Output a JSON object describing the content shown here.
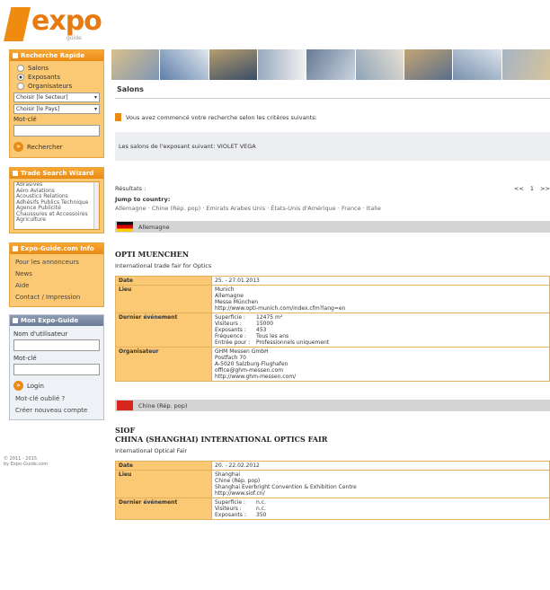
{
  "logo": {
    "word": "expo",
    "sub": "guide"
  },
  "sidebar": {
    "quick_search": {
      "title": "Recherche Rapide",
      "radios": [
        {
          "label": "Salons",
          "checked": false
        },
        {
          "label": "Exposants",
          "checked": true
        },
        {
          "label": "Organisateurs",
          "checked": false
        }
      ],
      "select_sector": "Choisir [le Secteur]",
      "select_country": "Choisir [le Pays]",
      "field_label": "Mot-clé",
      "button_label": "Rechercher"
    },
    "trade_search": {
      "title": "Trade Search Wizard",
      "items": [
        "Abrasives",
        "Aéro Aviations",
        "Acoustics Relations",
        "Adhésifs Publics Technique",
        "Agence Publicité",
        "Chaussures et Accessoires",
        "Agriculture"
      ]
    },
    "expo_guide": {
      "title": "Expo-Guide.com Info",
      "items": [
        "Pour les annonceurs",
        "News",
        "Aide",
        "Contact / Impression"
      ]
    },
    "my_guide": {
      "title": "Mon Expo-Guide",
      "user_label": "Nom d'utilisateur",
      "pass_label": "Mot-clé",
      "login_label": "Login",
      "forgot": "Mot-clé oublié ?",
      "register": "Créer nouveau compte"
    },
    "copyright": [
      "© 2011 - 2015",
      "by Expo-Guide.com"
    ]
  },
  "main": {
    "page_title": "Salons",
    "notice": "Vous avez commencé votre recherche selon les critères suivants:",
    "info": "Les salons de l'exposant suivant: VIOLET VEGA",
    "results_label": "Résultats :",
    "pager": [
      "<<",
      "1",
      ">>"
    ],
    "jump_label": "Jump to country:",
    "countries": "Allemagne  ·  Chine (Rép. pop)  ·  Emirats Arabes Unis  ·  États-Unis d'Amérique  ·  France  ·  Italie",
    "fairs": [
      {
        "country": "Allemagne",
        "flag": "de",
        "name": "OPTI MUENCHEN",
        "name2": "",
        "subtitle": "International trade fair for Optics",
        "rows": [
          {
            "key": "Date",
            "lines": [
              "25. - 27.01.2013"
            ]
          },
          {
            "key": "Lieu",
            "lines": [
              "Munich",
              "Allemagne",
              "Messe München",
              "http://www.opti-munich.com/index.cfm?lang=en"
            ]
          },
          {
            "key": "Dernier événement",
            "pairs": [
              [
                "Superficie :",
                "12475 m²"
              ],
              [
                "Visiteurs :",
                "15000"
              ],
              [
                "Exposants :",
                "453"
              ],
              [
                "Fréquence :",
                "Tous les ans"
              ],
              [
                "Entrée pour :",
                "Professionnels uniquement"
              ]
            ]
          },
          {
            "key": "Organisateur",
            "lines": [
              "GHM Messen GmbH",
              "Postfach 70",
              "A-5020 Salzburg-Flughafen",
              "office@ghm-messen.com",
              "http://www.ghm-messen.com/"
            ]
          }
        ]
      },
      {
        "country": "Chine (Rép. pop)",
        "flag": "cn",
        "name": "SIOF",
        "name2": "CHINA (SHANGHAI) INTERNATIONAL OPTICS FAIR",
        "subtitle": "International Optical Fair",
        "rows": [
          {
            "key": "Date",
            "lines": [
              "20. - 22.02.2012"
            ]
          },
          {
            "key": "Lieu",
            "lines": [
              "Shanghai",
              "Chine (Rép. pop)",
              "Shanghai Everbright Convention & Exhibition Centre",
              "http://www.siof.cn/"
            ]
          },
          {
            "key": "Dernier événement",
            "pairs": [
              [
                "Superficie :",
                "n.c."
              ],
              [
                "Visiteurs :",
                "n.c."
              ],
              [
                "Exposants :",
                "350"
              ]
            ]
          }
        ]
      }
    ]
  }
}
